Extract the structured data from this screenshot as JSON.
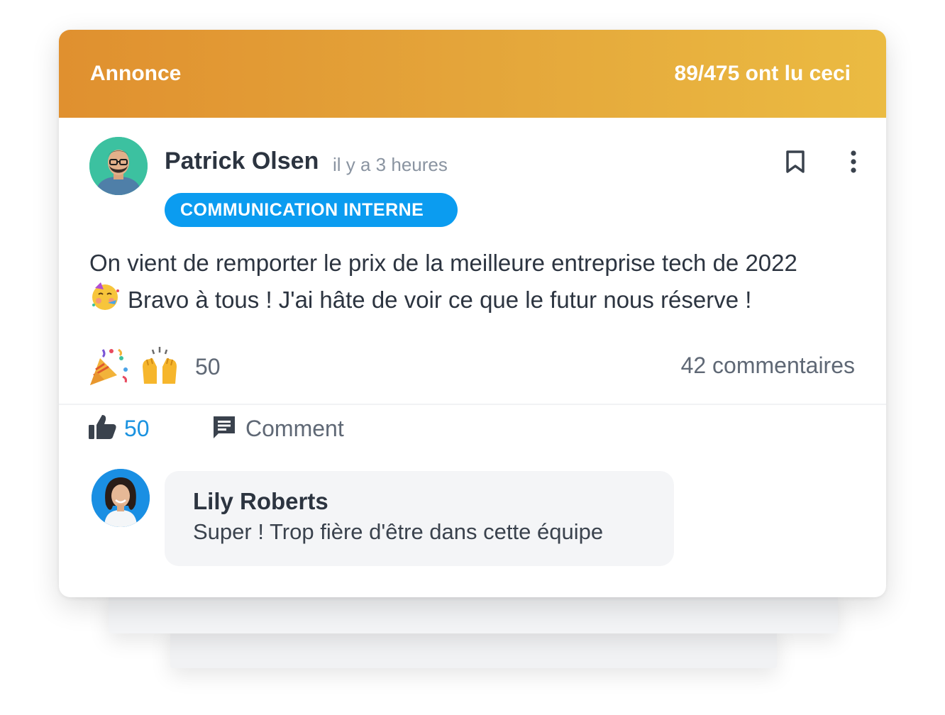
{
  "banner": {
    "label": "Annonce",
    "read_status": "89/475 ont lu ceci"
  },
  "post": {
    "author": "Patrick Olsen",
    "timestamp": "il y a 3 heures",
    "tag": "COMMUNICATION INTERNE",
    "body_line1": "On vient de remporter le prix de la meilleure entreprise tech de 2022",
    "body_line2": "Bravo à tous ! J'ai hâte de voir ce que le futur nous réserve !",
    "body_emoji": "partying-face-emoji",
    "reaction_emojis": [
      "party-popper-emoji",
      "raising-hands-emoji"
    ],
    "reaction_count": "50",
    "comments_count": "42 commentaires",
    "like_count": "50",
    "comment_label": "Comment"
  },
  "comment": {
    "author": "Lily Roberts",
    "text": "Super ! Trop fière d'être dans cette équipe"
  },
  "colors": {
    "banner_start": "#e0902f",
    "banner_end": "#ebbb42",
    "tag_bg": "#0b9cf0",
    "like_accent": "#1a92e0",
    "text_primary": "#2c3440",
    "text_secondary": "#8a94a1"
  },
  "icons": {
    "bookmark": "bookmark-icon",
    "more": "more-vertical-icon",
    "like": "thumbs-up-icon",
    "comment": "comment-icon"
  }
}
